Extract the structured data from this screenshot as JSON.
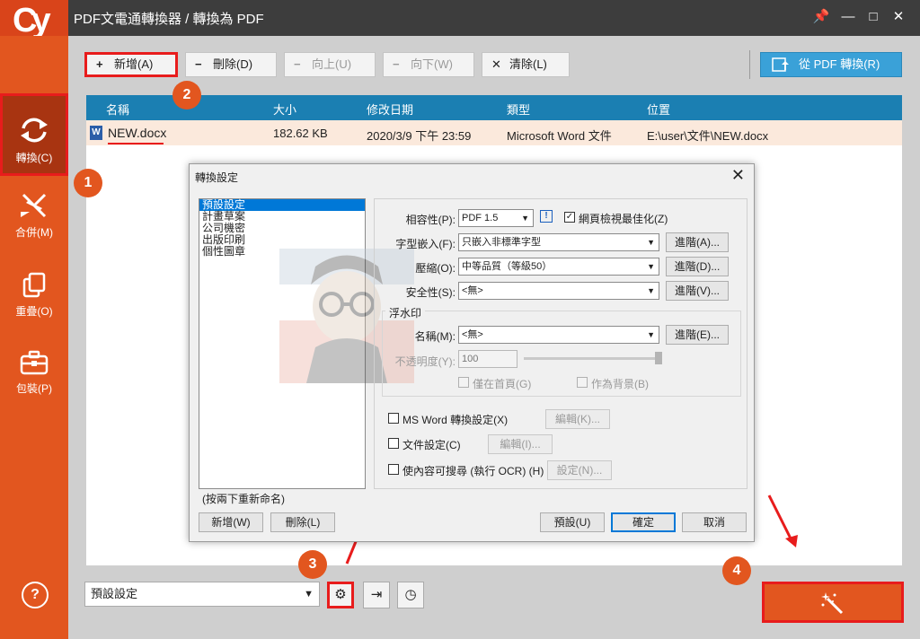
{
  "app": {
    "title": "PDF文電通轉換器 / 轉換為 PDF"
  },
  "sidebar": {
    "items": [
      {
        "label": "轉換(C)"
      },
      {
        "label": "合併(M)"
      },
      {
        "label": "重疊(O)"
      },
      {
        "label": "包裝(P)"
      }
    ],
    "help": "?"
  },
  "toolbar": {
    "add": "新增(A)",
    "delete": "刪除(D)",
    "up": "向上(U)",
    "down": "向下(W)",
    "clear": "清除(L)",
    "from_pdf": "從 PDF 轉換(R)"
  },
  "table": {
    "columns": [
      "名稱",
      "大小",
      "修改日期",
      "類型",
      "位置"
    ],
    "rows": [
      {
        "name": "NEW.docx",
        "size": "182.62 KB",
        "date": "2020/3/9 下午 23:59",
        "type": "Microsoft Word 文件",
        "location": "E:\\user\\文件\\NEW.docx"
      }
    ]
  },
  "bottom": {
    "profile": "預設設定"
  },
  "badges": [
    "1",
    "2",
    "3",
    "4"
  ],
  "dialog": {
    "title": "轉換設定",
    "profiles": [
      "預設設定",
      "計畫草案",
      "公司機密",
      "出版印刷",
      "個性圖章"
    ],
    "hint": "(按兩下重新命名)",
    "new_btn": "新增(W)",
    "delete_btn": "刪除(L)",
    "default_btn": "預設(U)",
    "ok_btn": "確定",
    "cancel_btn": "取消",
    "compat_label": "相容性(P):",
    "compat_value": "PDF 1.5",
    "web_opt": "網頁檢視最佳化(Z)",
    "font_label": "字型嵌入(F):",
    "font_value": "只嵌入非標準字型",
    "compress_label": "壓縮(O):",
    "compress_value": "中等品質（等級50）",
    "security_label": "安全性(S):",
    "security_value": "<無>",
    "adv_a": "進階(A)...",
    "adv_d": "進階(D)...",
    "adv_v": "進階(V)...",
    "watermark_title": "浮水印",
    "wm_name_label": "名稱(M):",
    "wm_name_value": "<無>",
    "adv_e": "進階(E)...",
    "opacity_label": "不透明度(Y):",
    "opacity_value": "100",
    "first_page": "僅在首頁(G)",
    "as_background": "作為背景(B)",
    "msword": "MS Word 轉換設定(X)",
    "edit_k": "編輯(K)...",
    "docset": "文件設定(C)",
    "edit_i": "編輯(I)...",
    "ocr": "使內容可搜尋 (執行 OCR) (H)",
    "setup_n": "設定(N)..."
  }
}
